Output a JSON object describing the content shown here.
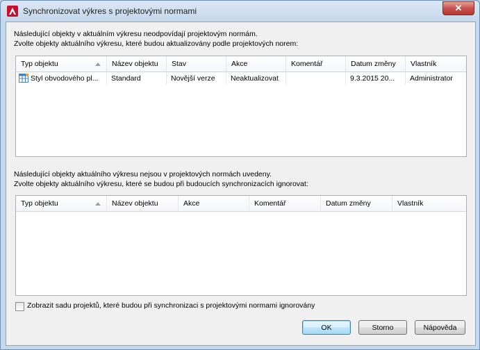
{
  "window": {
    "title": "Synchronizovat výkres s projektovými normami",
    "close_label": "✕"
  },
  "section1": {
    "line1": "Následující objekty v aktuálním výkresu neodpovídají projektovým normám.",
    "line2": "Zvolte objekty aktuálního výkresu, které budou aktualizovány podle projektových norem:",
    "columns": [
      "Typ objektu",
      "Název objektu",
      "Stav",
      "Akce",
      "Komentář",
      "Datum změny",
      "Vlastník"
    ],
    "rows": [
      {
        "typ": "Styl obvodového pl...",
        "nazev": "Standard",
        "stav": "Novější verze",
        "akce": "Neaktualizovat",
        "komentar": "",
        "datum": "9.3.2015 20...",
        "vlastnik": "Administrator"
      }
    ]
  },
  "section2": {
    "line1": "Následující objekty aktuálního výkresu nejsou v projektových normách uvedeny.",
    "line2": "Zvolte objekty aktuálního výkresu, které se budou při budoucích synchronizacích ignorovat:",
    "columns": [
      "Typ objektu",
      "Název objektu",
      "Akce",
      "Komentář",
      "Datum změny",
      "Vlastník"
    ],
    "rows": []
  },
  "checkbox": {
    "label": "Zobrazit sadu projektů, které budou při synchronizaci s projektovými normami ignorovány",
    "checked": false
  },
  "buttons": {
    "ok": "OK",
    "cancel": "Storno",
    "help": "Nápověda"
  },
  "colors": {
    "accent_default_button": "#3c7fb1",
    "app_icon_red": "#c8102e"
  }
}
